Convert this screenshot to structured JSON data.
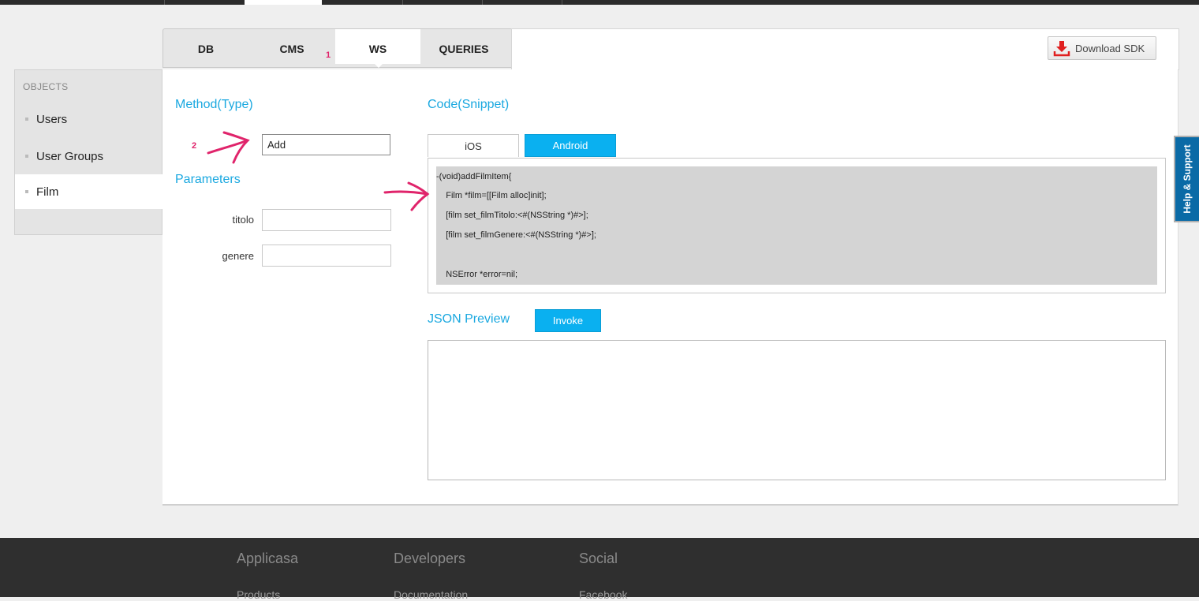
{
  "tabs": [
    {
      "label": "DB"
    },
    {
      "label": "CMS"
    },
    {
      "label": "WS"
    },
    {
      "label": "QUERIES"
    }
  ],
  "toolbar": {
    "download_label": "Download SDK"
  },
  "sidebar": {
    "heading": "OBJECTS",
    "items": [
      {
        "label": "Users"
      },
      {
        "label": "User Groups"
      },
      {
        "label": "Film"
      }
    ]
  },
  "method": {
    "heading": "Method(Type)",
    "value": "Add"
  },
  "parameters": {
    "heading": "Parameters",
    "fields": [
      {
        "label": "titolo",
        "value": ""
      },
      {
        "label": "genere",
        "value": ""
      }
    ]
  },
  "code": {
    "heading": "Code(Snippet)",
    "tabs": [
      {
        "label": "iOS"
      },
      {
        "label": "Android"
      }
    ],
    "lines": [
      "-(void)addFilmItem{",
      "    Film *film=[[Film alloc]init];",
      "    [film set_filmTitolo:<#(NSString *)#>];",
      "    [film set_filmGenere:<#(NSString *)#>];",
      "",
      "    NSError *error=nil;"
    ]
  },
  "json": {
    "heading": "JSON Preview",
    "invoke_label": "Invoke",
    "content": ""
  },
  "help": {
    "label": "Help & Support"
  },
  "annotations": {
    "marker1": "1",
    "marker2": "2"
  },
  "footer": {
    "columns": [
      {
        "heading": "Applicasa",
        "link": "Products"
      },
      {
        "heading": "Developers",
        "link": "Documentation"
      },
      {
        "heading": "Social",
        "link": "Facebook"
      }
    ]
  },
  "colors": {
    "accent": "#0ab0f0",
    "heading": "#1aa8e0",
    "annotation": "#e0246b",
    "help": "#0a6aa6"
  }
}
